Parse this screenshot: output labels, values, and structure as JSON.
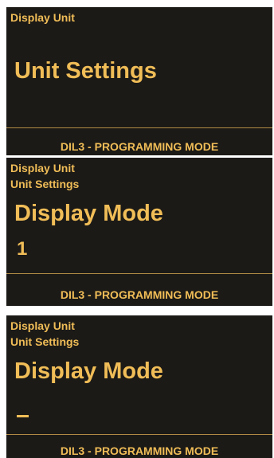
{
  "screens": [
    {
      "breadcrumbs": [
        "Display Unit"
      ],
      "title": "Unit Settings",
      "footer": "DIL3 - PROGRAMMING MODE"
    },
    {
      "breadcrumbs": [
        "Display Unit",
        "Unit Settings"
      ],
      "title": "Display Mode",
      "value": "1",
      "footer": "DIL3 - PROGRAMMING MODE"
    },
    {
      "breadcrumbs": [
        "Display Unit",
        "Unit Settings"
      ],
      "title": "Display Mode",
      "value_cursor": "_",
      "footer": "DIL3 - PROGRAMMING MODE"
    }
  ],
  "colors": {
    "screen_background": "#1c1a17",
    "text": "#f0bd57",
    "divider": "#b08a45"
  }
}
